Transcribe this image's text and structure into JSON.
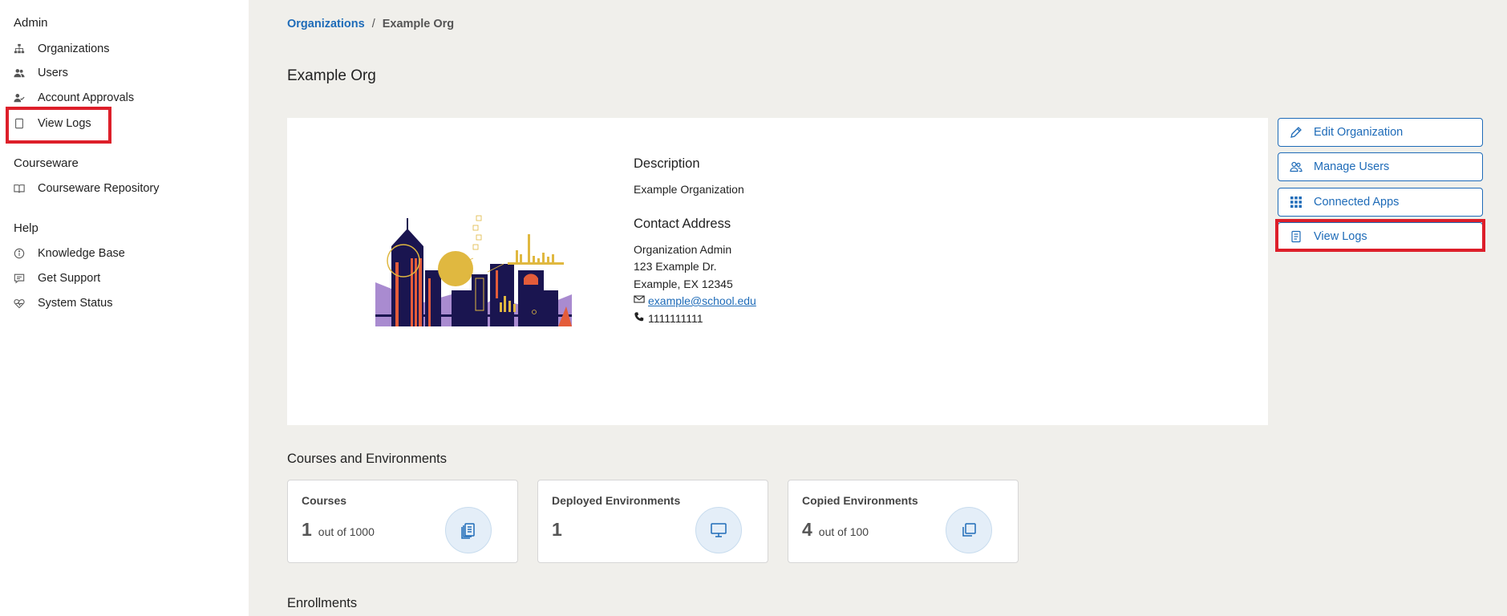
{
  "sidebar": {
    "sections": [
      {
        "title": "Admin",
        "items": [
          {
            "label": "Organizations",
            "icon": "sitemap-icon"
          },
          {
            "label": "Users",
            "icon": "users-icon"
          },
          {
            "label": "Account Approvals",
            "icon": "user-check-icon"
          },
          {
            "label": "View Logs",
            "icon": "log-icon"
          }
        ]
      },
      {
        "title": "Courseware",
        "items": [
          {
            "label": "Courseware Repository",
            "icon": "book-icon"
          }
        ]
      },
      {
        "title": "Help",
        "items": [
          {
            "label": "Knowledge Base",
            "icon": "info-icon"
          },
          {
            "label": "Get Support",
            "icon": "support-chat-icon"
          },
          {
            "label": "System Status",
            "icon": "heartbeat-icon"
          }
        ]
      }
    ]
  },
  "breadcrumb": {
    "parent": "Organizations",
    "separator": "/",
    "current": "Example Org"
  },
  "page_title": "Example Org",
  "org": {
    "description_heading": "Description",
    "description": "Example Organization",
    "contact_heading": "Contact Address",
    "contact_name": "Organization Admin",
    "address_line1": "123 Example Dr.",
    "address_line2": "Example, EX 12345",
    "email": "example@school.edu",
    "phone": "1111111111"
  },
  "actions": [
    {
      "label": "Edit Organization",
      "icon": "pencil-icon"
    },
    {
      "label": "Manage Users",
      "icon": "users-outline-icon"
    },
    {
      "label": "Connected Apps",
      "icon": "grid-icon"
    },
    {
      "label": "View Logs",
      "icon": "log-icon"
    }
  ],
  "courses_section": {
    "title": "Courses and Environments"
  },
  "stats": [
    {
      "label": "Courses",
      "value": "1",
      "sub": "out of 1000",
      "icon": "stacked-pages-icon"
    },
    {
      "label": "Deployed Environments",
      "value": "1",
      "sub": "",
      "icon": "monitor-icon"
    },
    {
      "label": "Copied Environments",
      "value": "4",
      "sub": "out of 100",
      "icon": "copy-icon"
    }
  ],
  "enrollments_section": {
    "title": "Enrollments"
  },
  "colors": {
    "accent": "#1e6bb8",
    "highlight": "#dd1f2a",
    "background": "#f0efeb"
  }
}
